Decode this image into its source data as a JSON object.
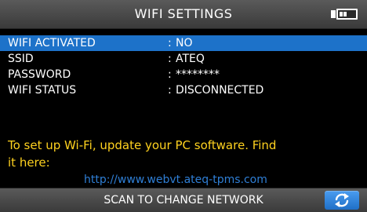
{
  "header": {
    "title": "WIFI SETTINGS"
  },
  "settings": [
    {
      "label": "WIFI ACTIVATED",
      "value": "NO",
      "selected": true
    },
    {
      "label": "SSID",
      "value": "ATEQ",
      "selected": false
    },
    {
      "label": "PASSWORD",
      "value": "********",
      "selected": false
    },
    {
      "label": "WIFI STATUS",
      "value": "DISCONNECTED",
      "selected": false
    }
  ],
  "info": {
    "text": "To set up Wi-Fi, update your PC software. Find it here:",
    "link": "http://www.webvt.ateq-tpms.com"
  },
  "footer": {
    "scan_label": "SCAN TO CHANGE NETWORK"
  },
  "icons": {
    "battery": "battery-icon",
    "refresh": "refresh-icon"
  },
  "colors": {
    "selected_row": "#1d72c9",
    "info_text": "#ffd21f",
    "link_text": "#2f7fd6"
  }
}
